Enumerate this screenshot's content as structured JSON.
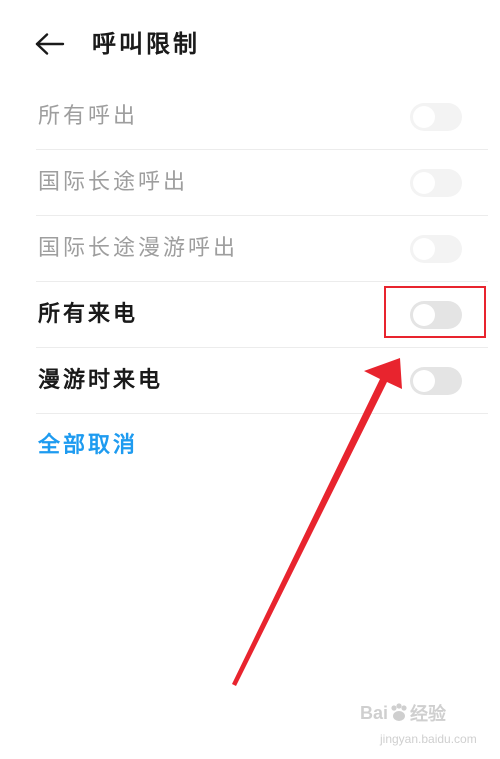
{
  "header": {
    "back_icon": "arrow-left-icon",
    "title": "呼叫限制"
  },
  "settings": [
    {
      "label": "所有呼出",
      "enabled": false,
      "on": false
    },
    {
      "label": "国际长途呼出",
      "enabled": false,
      "on": false
    },
    {
      "label": "国际长途漫游呼出",
      "enabled": false,
      "on": false
    },
    {
      "label": "所有来电",
      "enabled": true,
      "on": false
    },
    {
      "label": "漫游时来电",
      "enabled": true,
      "on": false
    }
  ],
  "actions": {
    "cancel_all_label": "全部取消",
    "cancel_all_color": "#1e9bf0"
  },
  "annotation": {
    "highlight_color": "#e8242e",
    "arrow_color": "#e8242e"
  },
  "watermark": {
    "brand": "Bai",
    "brand_suffix": "经验",
    "url": "jingyan.baidu.com"
  }
}
